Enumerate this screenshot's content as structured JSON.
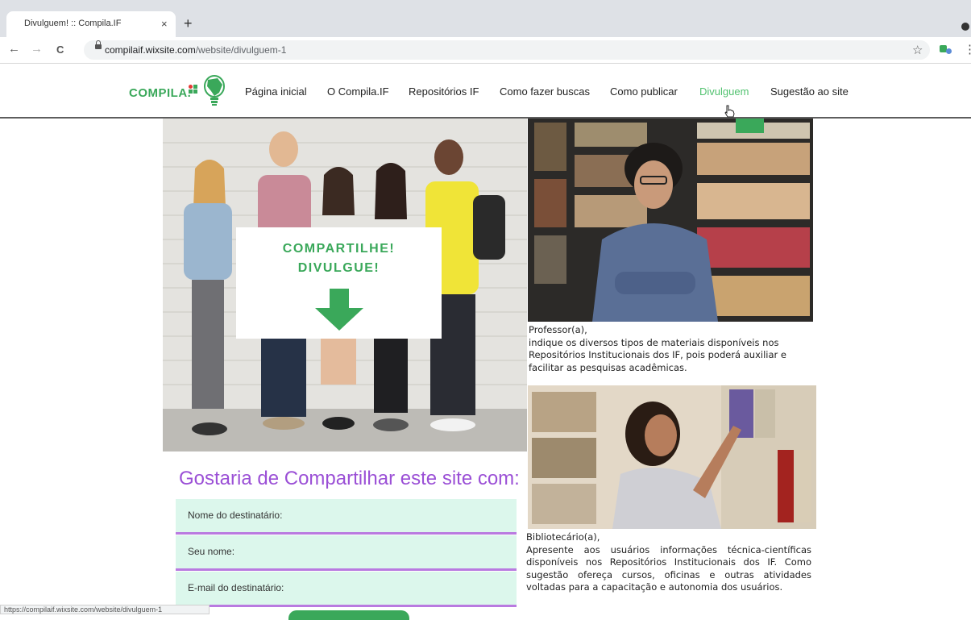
{
  "browser": {
    "tab_title": "Divulguem! :: Compila.IF",
    "tab_close": "×",
    "new_tab": "+",
    "back": "←",
    "forward": "→",
    "reload": "C",
    "url_domain": "compilaif.wixsite.com",
    "url_path": "/website/divulguem-1",
    "bookmark": "☆",
    "menu": "⋮"
  },
  "header": {
    "logo_text": "COMPILA.",
    "nav": [
      {
        "label": "Página inicial"
      },
      {
        "label": "O Compila.IF"
      },
      {
        "label": "Repositórios IF"
      },
      {
        "label": "Como fazer buscas"
      },
      {
        "label": "Como publicar"
      },
      {
        "label": "Divulguem"
      },
      {
        "label": "Sugestão ao site"
      }
    ],
    "active_color": "#51c26f"
  },
  "hero": {
    "sign_line1": "COMPARTILHE!",
    "sign_line2": "DIVULGUE!"
  },
  "professor": {
    "heading": "Professor(a),",
    "body": "indique os diversos tipos de materiais disponíveis nos Repositórios Institucionais dos IF, pois poderá auxiliar e facilitar as pesquisas acadêmicas."
  },
  "bibliotecario": {
    "heading": "Bibliotecário(a),",
    "body": "Apresente aos usuários informações técnica-científicas disponíveis nos Repositórios Institucionais dos IF. Como sugestão ofereça cursos, oficinas e outras atividades voltadas para a capacitação e autonomia dos usuários."
  },
  "share": {
    "title": "Gostaria de Compartilhar este site com:",
    "fields": [
      {
        "label": "Nome do destinatário:"
      },
      {
        "label": "Seu nome:"
      },
      {
        "label": "E-mail do destinatário:"
      }
    ],
    "title_color": "#9b50d6",
    "field_color": "#dcf7ec"
  },
  "status_bar": {
    "url": "https://compilaif.wixsite.com/website/divulguem-1"
  }
}
